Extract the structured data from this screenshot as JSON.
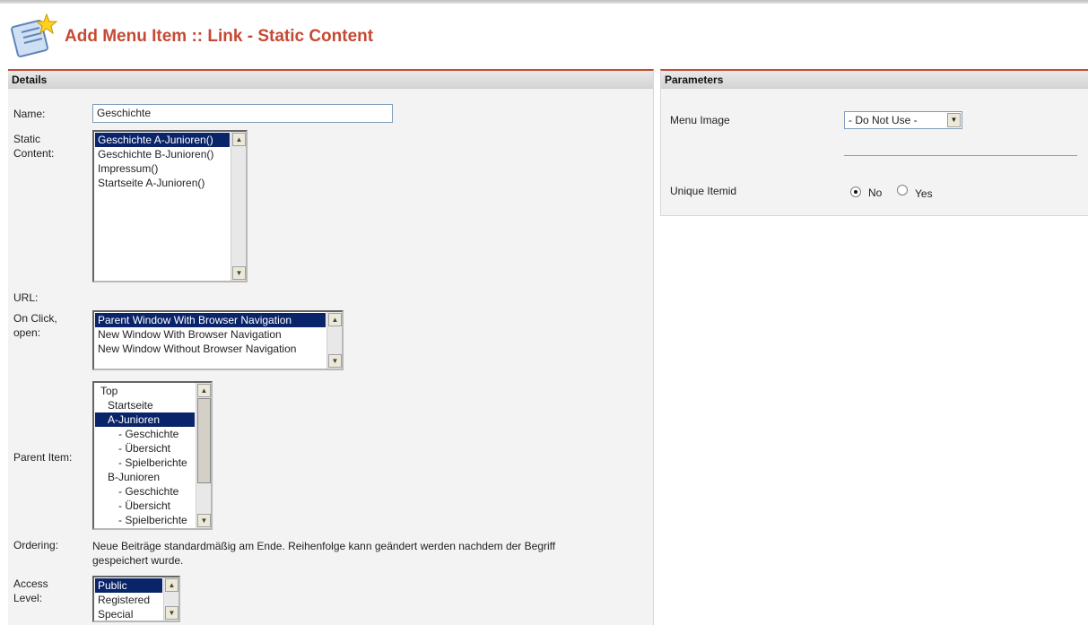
{
  "page": {
    "title": "Add Menu Item :: Link - Static Content",
    "title_color": "#c64934"
  },
  "details": {
    "heading": "Details",
    "name": {
      "label": "Name:",
      "value": "Geschichte"
    },
    "static_content": {
      "label_line1": "Static",
      "label_line2": "Content:",
      "options": [
        "Geschichte A-Junioren()",
        "Geschichte B-Junioren()",
        "Impressum()",
        "Startseite A-Junioren()"
      ],
      "selected": "Geschichte A-Junioren()"
    },
    "url": {
      "label": "URL:"
    },
    "on_click": {
      "label_line1": "On Click,",
      "label_line2": "open:",
      "options": [
        "Parent Window With Browser Navigation",
        "New Window With Browser Navigation",
        "New Window Without Browser Navigation"
      ],
      "selected": "Parent Window With Browser Navigation"
    },
    "parent_item": {
      "label": "Parent Item:",
      "options": [
        "Top",
        "Startseite",
        "A-Junioren",
        "- Geschichte",
        "- Übersicht",
        "- Spielberichte",
        "B-Junioren",
        "- Geschichte",
        "- Übersicht",
        "- Spielberichte"
      ],
      "selected": "A-Junioren"
    },
    "ordering": {
      "label": "Ordering:",
      "text_line1": "Neue Beiträge standardmäßig am Ende. Reihenfolge kann geändert werden nachdem der Begriff",
      "text_line2": "gespeichert wurde."
    },
    "access_level": {
      "label_line1": "Access",
      "label_line2": "Level:",
      "options": [
        "Public",
        "Registered",
        "Special"
      ],
      "selected": "Public"
    }
  },
  "parameters": {
    "heading": "Parameters",
    "menu_image": {
      "label": "Menu Image",
      "value": "- Do Not Use -"
    },
    "unique_itemid": {
      "label": "Unique Itemid",
      "options": [
        "No",
        "Yes"
      ],
      "selected": "No"
    }
  },
  "icons": {
    "header": "menu-item-star-icon"
  },
  "colors": {
    "accent": "#c64934",
    "selection": "#0a246a",
    "panel_bg": "#f3f3f3"
  }
}
